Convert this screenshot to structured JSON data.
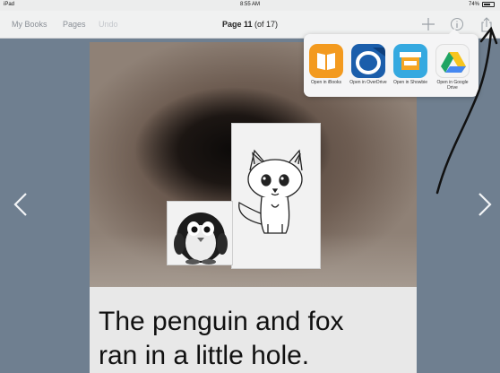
{
  "status_bar": {
    "device": "iPad",
    "time": "8:55 AM",
    "battery": "74%",
    "battery_level": 0.74
  },
  "toolbar": {
    "my_books": "My Books",
    "pages": "Pages",
    "undo": "Undo",
    "page_title": "Page 11",
    "page_count": "(of 17)"
  },
  "share_menu": {
    "apps": [
      {
        "label": "Open in iBooks",
        "icon": "ibooks-icon",
        "color": "#f39a1f"
      },
      {
        "label": "Open in OverDrive",
        "icon": "overdrive-icon",
        "color": "#1b5eab"
      },
      {
        "label": "Open in Showbie",
        "icon": "showbie-icon",
        "color": "#35a9e0"
      },
      {
        "label": "Open in Google Drive",
        "icon": "google-drive-icon",
        "color": "#f4f4f4"
      }
    ]
  },
  "page": {
    "story_text_line1": "The penguin and fox",
    "story_text_line2": "ran in a little hole."
  }
}
